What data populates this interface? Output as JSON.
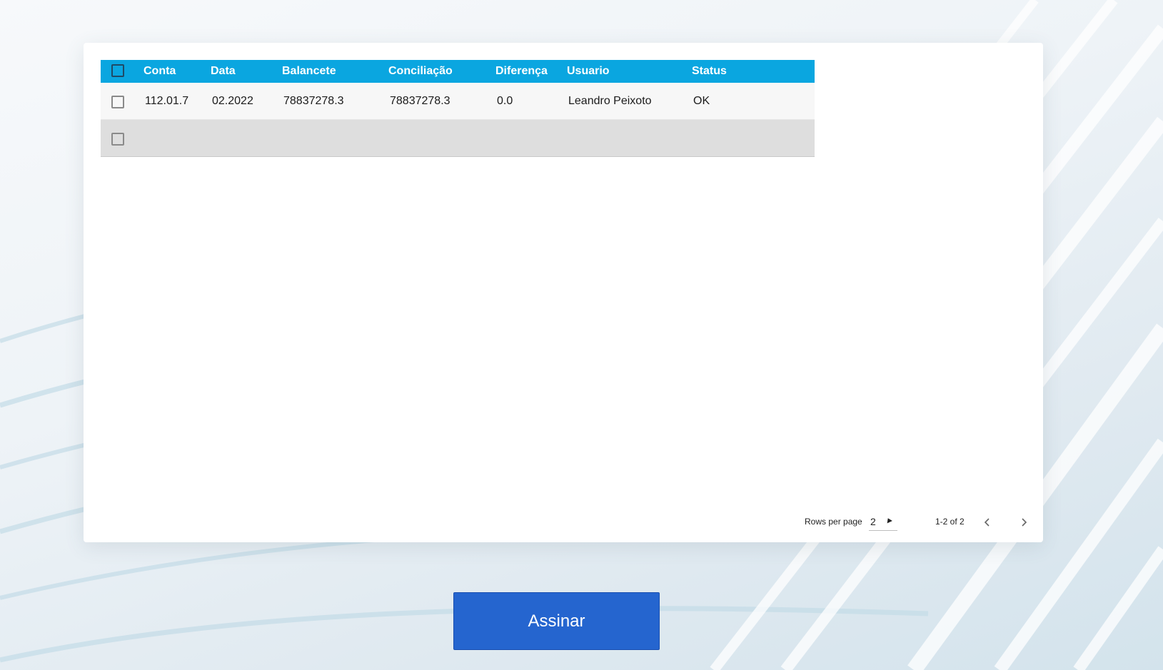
{
  "table": {
    "columns": [
      "Conta",
      "Data",
      "Balancete",
      "Conciliação",
      "Diferença",
      "Usuario",
      "Status"
    ],
    "rows": [
      [
        "112.01.7",
        "02.2022",
        "78837278.3",
        "78837278.3",
        "0.0",
        "Leandro Peixoto",
        "OK"
      ],
      [
        "",
        "",
        "",
        "",
        "",
        "",
        ""
      ]
    ]
  },
  "pagination": {
    "rows_per_page_label": "Rows per page",
    "rows_per_page_value": "2",
    "range_text": "1-2 of 2"
  },
  "actions": {
    "sign_label": "Assinar"
  },
  "colors": {
    "header": "#0aa6e0",
    "primary_button": "#2565cf"
  }
}
